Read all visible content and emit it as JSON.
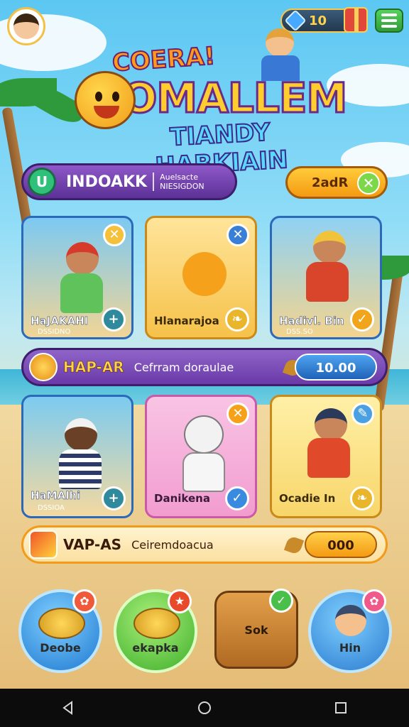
{
  "header": {
    "coin_value": "10"
  },
  "title": {
    "small": "COERA!",
    "big": "OMALLEM",
    "sub": "TIANDY HABKIAIN"
  },
  "banner": {
    "name": "INDOAKK",
    "sub_line1": "Auelsacte",
    "sub_line2": "NIESIGDON",
    "button_label": "2adR"
  },
  "cards_row1": [
    {
      "label": "HaJAKAHI",
      "sublabel": "DSSIDNO"
    },
    {
      "label": "Hlanarajoa"
    },
    {
      "label": "Hadivl. Bin",
      "sublabel": "DSS.SO"
    }
  ],
  "bar1": {
    "title": "HAP-AR",
    "desc": "Cefrram doraulae",
    "value": "10.00"
  },
  "cards_row2": [
    {
      "label": "HaMAlhi",
      "sublabel": "DSSIOA"
    },
    {
      "label": "Danikena"
    },
    {
      "label": "Ocadie In"
    }
  ],
  "bar2": {
    "title": "VAP-AS",
    "desc": "Ceiremdoacua",
    "value": "000"
  },
  "bottom": [
    {
      "label": "Deobe"
    },
    {
      "label": "ekapka"
    },
    {
      "label": "Sok"
    },
    {
      "label": "Hin"
    }
  ],
  "colors": {
    "banner_purple": "#6a3aa8",
    "button_orange": "#f6a81c",
    "accent_green": "#5cc84a",
    "accent_red": "#e4452f",
    "accent_blue": "#2f7fd8"
  }
}
